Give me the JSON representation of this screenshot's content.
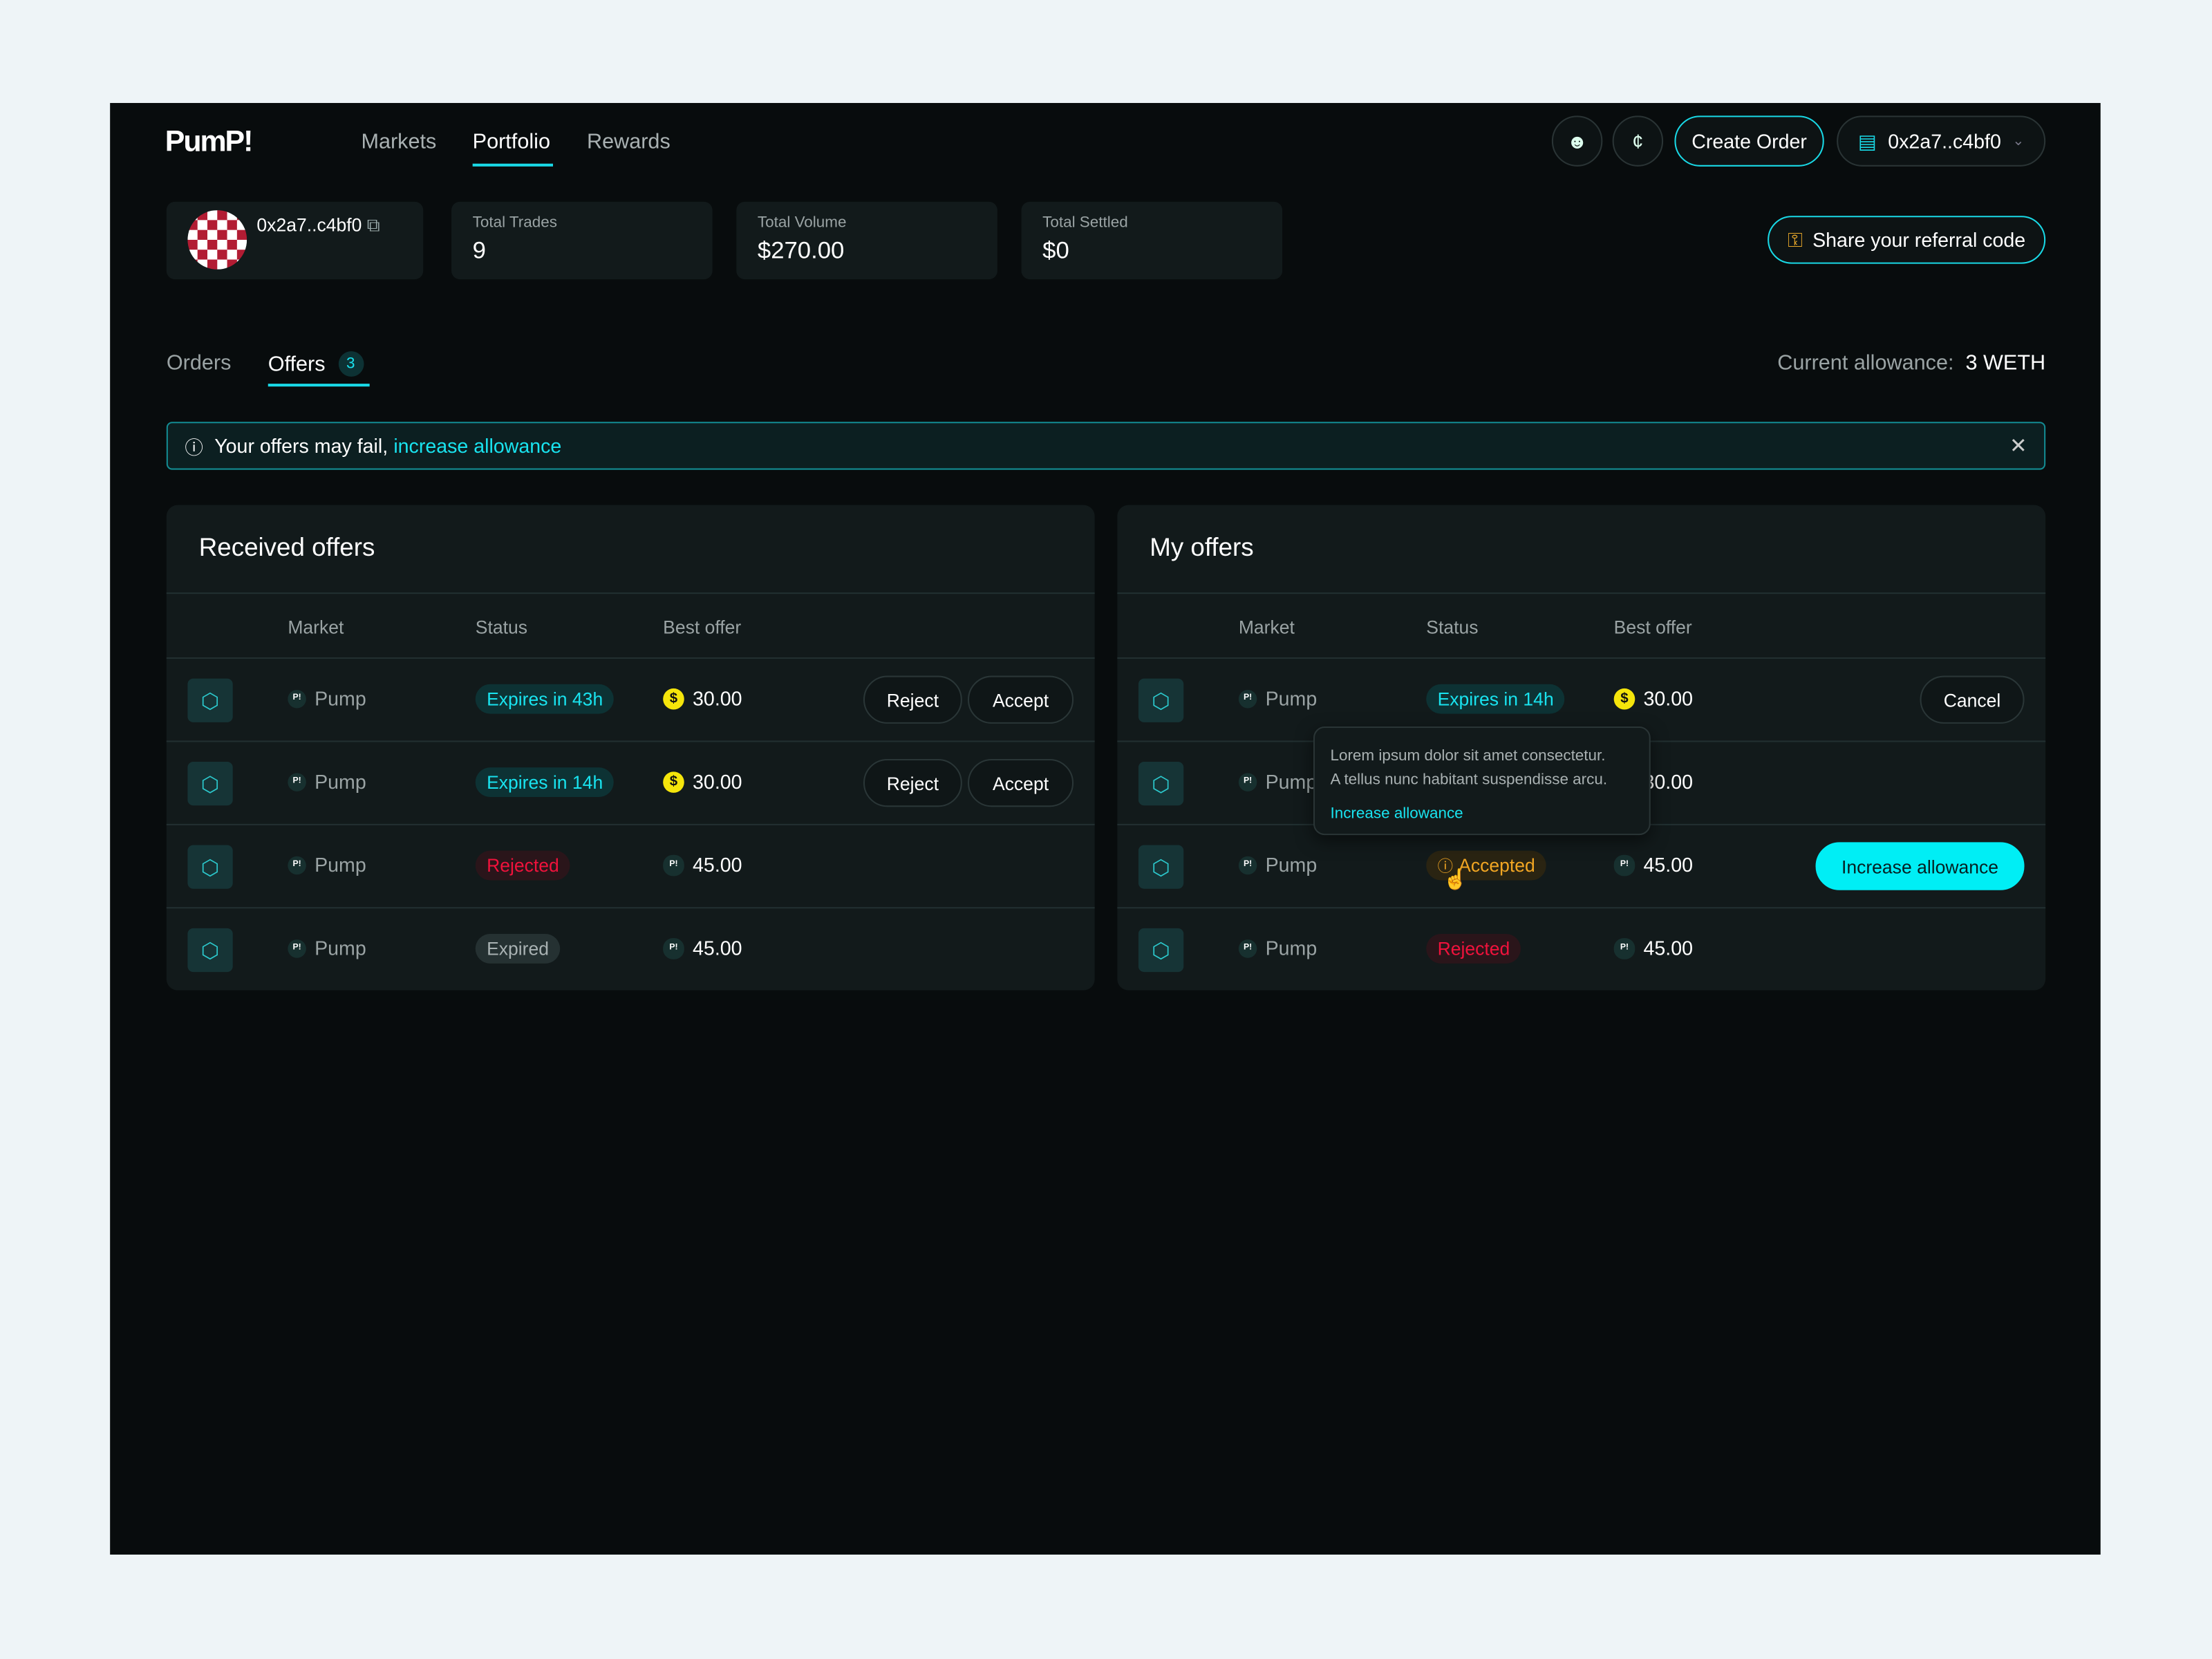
{
  "header": {
    "logo": "PumP!",
    "nav": [
      {
        "label": "Markets"
      },
      {
        "label": "Portfolio",
        "active": true
      },
      {
        "label": "Rewards"
      }
    ],
    "icons": [
      "user-plus-icon",
      "coin-icon"
    ],
    "create_order": "Create Order",
    "wallet": "0x2a7..c4bf0"
  },
  "profile": {
    "address": "0x2a7..c4bf0"
  },
  "stats": [
    {
      "label": "Total Trades",
      "value": "9"
    },
    {
      "label": "Total Volume",
      "value": "$270.00"
    },
    {
      "label": "Total Settled",
      "value": "$0"
    }
  ],
  "referral": "Share your referral code",
  "tabs": {
    "orders": "Orders",
    "offers": "Offers",
    "offers_count": "3"
  },
  "allowance": {
    "label": "Current allowance:",
    "value": "3 WETH"
  },
  "alert": {
    "text": "Your offers may fail,",
    "link": "increase allowance"
  },
  "colors": {
    "accent": "#19e3ef",
    "danger": "#f0123c",
    "warning": "#f2a623",
    "background": "#080c0d"
  },
  "received": {
    "title": "Received offers",
    "columns": [
      "Market",
      "Status",
      "Best offer"
    ],
    "rows": [
      {
        "market": "Pump",
        "status": "Expires in 43h",
        "offer": "30.00",
        "actions": [
          "Reject",
          "Accept"
        ]
      },
      {
        "market": "Pump",
        "status": "Expires in 14h",
        "offer": "30.00",
        "actions": [
          "Reject",
          "Accept"
        ]
      },
      {
        "market": "Pump",
        "status": "Rejected",
        "offer": "45.00"
      },
      {
        "market": "Pump",
        "status": "Expired",
        "offer": "45.00"
      }
    ]
  },
  "mine": {
    "title": "My offers",
    "columns": [
      "Market",
      "Status",
      "Best offer"
    ],
    "rows": [
      {
        "market": "Pump",
        "status": "Expires in 14h",
        "offer": "30.00",
        "action": "Cancel"
      },
      {
        "market": "Pump",
        "offer": "30.00"
      },
      {
        "market": "Pump",
        "status": "Accepted",
        "offer": "45.00",
        "action": "Increase allowance"
      },
      {
        "market": "Pump",
        "status": "Rejected",
        "offer": "45.00"
      }
    ]
  },
  "tooltip": {
    "line1": "Lorem ipsum dolor sit amet consectetur.",
    "line2": "A tellus nunc habitant suspendisse arcu.",
    "link": "Increase allowance"
  }
}
